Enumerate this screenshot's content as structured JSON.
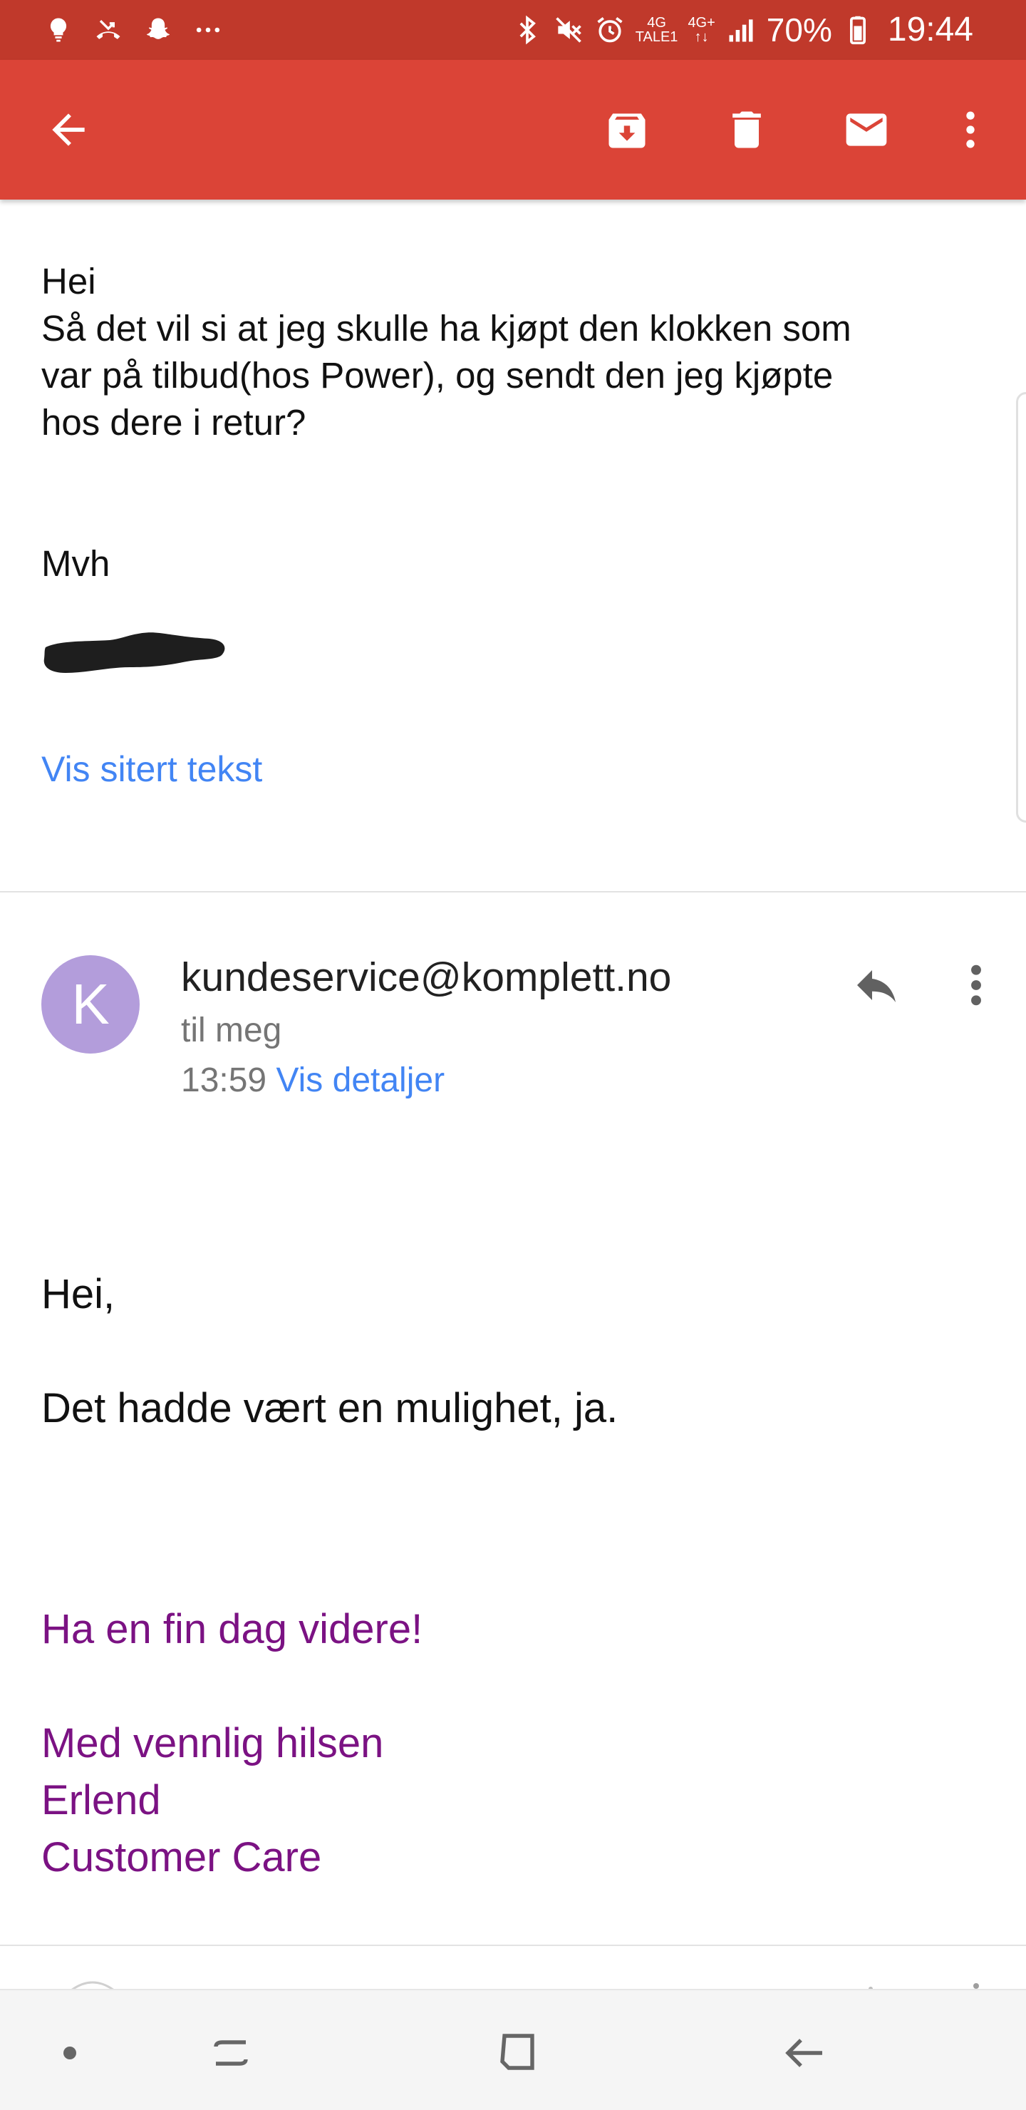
{
  "status_bar": {
    "left_icons": [
      "lightbulb-icon",
      "missed-call-icon",
      "snapchat-icon",
      "more-dots-icon"
    ],
    "right_icons": [
      "bluetooth-icon",
      "mute-icon",
      "alarm-icon"
    ],
    "network_top": "4G",
    "network_bottom": "TALE1",
    "network2": "4G+",
    "battery": "70%",
    "time": "19:44"
  },
  "toolbar": {
    "back_icon": "arrow-back-icon",
    "archive_icon": "archive-icon",
    "delete_icon": "trash-icon",
    "mark_unread_icon": "mail-icon",
    "more_icon": "more-vert-icon"
  },
  "message1": {
    "body": "Hei\nSå det vil si at jeg skulle ha kjøpt den klokken som\nvar på tilbud(hos Power), og sendt den jeg kjøpte\nhos dere i retur?",
    "sign_off": "Mvh",
    "quoted_link": "Vis sitert tekst"
  },
  "message2": {
    "avatar_letter": "K",
    "avatar_color": "#b39ddb",
    "sender": "kundeservice@komplett.no",
    "recipient": "til meg",
    "time": "13:59",
    "details_link": "Vis detaljer",
    "greeting": "Hei,",
    "text": "Det hadde vært en mulighet, ja.",
    "closing1": "Ha en fin dag videre!",
    "closing2": "Med vennlig hilsen",
    "closing3": "Erlend",
    "closing4": "Customer Care"
  },
  "colors": {
    "status_bar": "#c0392b",
    "toolbar": "#db4437",
    "link": "#4285f4",
    "signature": "#7b1283"
  }
}
